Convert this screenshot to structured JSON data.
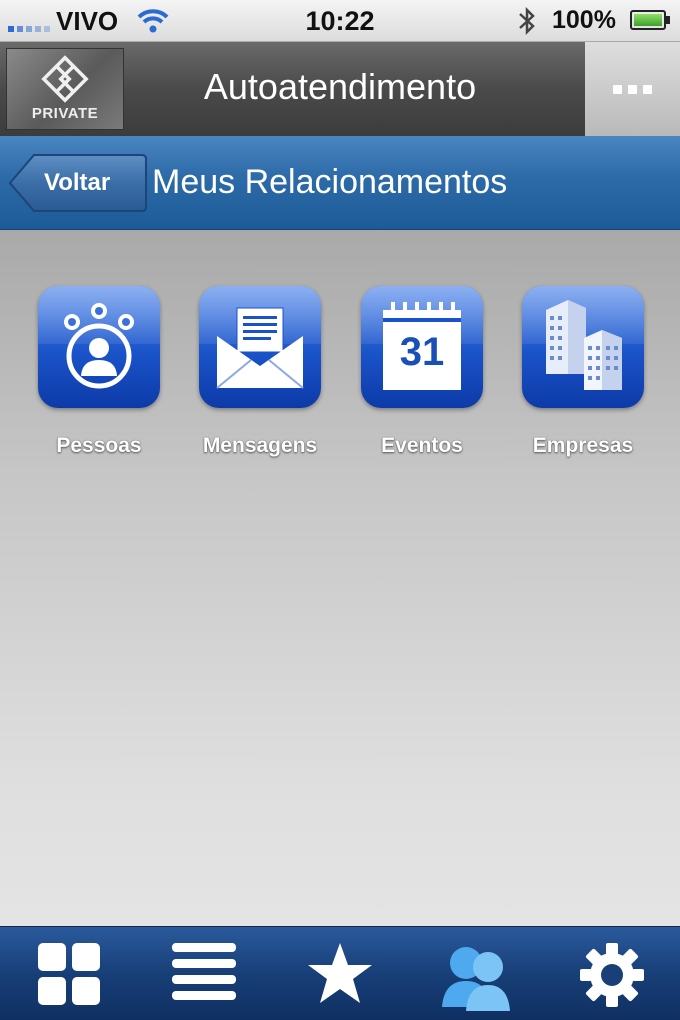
{
  "status_bar": {
    "carrier": "VIVO",
    "time": "10:22",
    "battery_percent": "100%"
  },
  "header": {
    "logo_text": "PRIVATE",
    "title": "Autoatendimento",
    "menu_icon": "more-dots-icon"
  },
  "subheader": {
    "back_label": "Voltar",
    "title": "Meus Relacionamentos"
  },
  "tiles": [
    {
      "label": "Pessoas",
      "icon": "people-icon"
    },
    {
      "label": "Mensagens",
      "icon": "envelope-icon"
    },
    {
      "label": "Eventos",
      "icon": "calendar-icon",
      "calendar_day": "31"
    },
    {
      "label": "Empresas",
      "icon": "buildings-icon"
    }
  ],
  "tabbar": {
    "items": [
      {
        "icon": "grid-icon"
      },
      {
        "icon": "list-icon"
      },
      {
        "icon": "star-icon"
      },
      {
        "icon": "contacts-icon",
        "selected": true
      },
      {
        "icon": "gear-icon"
      }
    ]
  },
  "colors": {
    "header_gray": "#4a4a4a",
    "subheader_blue": "#2c6aa8",
    "icon_blue": "#1a53c9",
    "tabbar_blue": "#183f78",
    "selected_tab": "#5ab0f0"
  }
}
